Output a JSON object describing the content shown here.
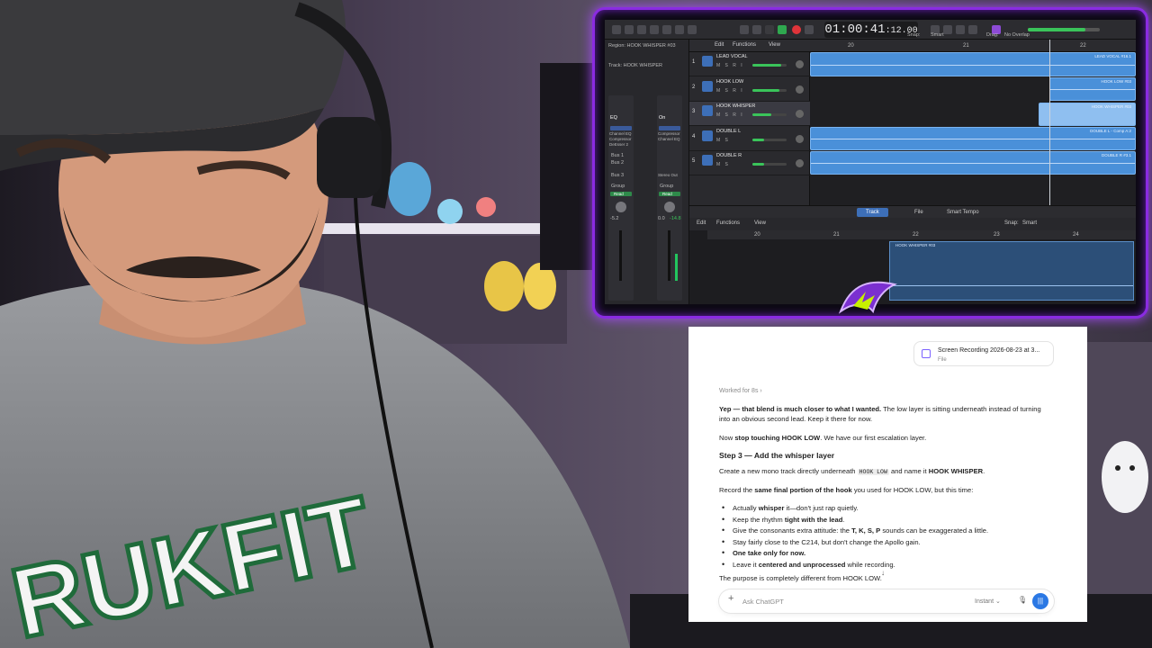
{
  "daw": {
    "region_label": "Region: HOOK WHISPER #03",
    "track_label": "Track: HOOK WHISPER",
    "menu": {
      "edit": "Edit",
      "functions": "Functions",
      "view": "View"
    },
    "snap_label": "Snap:",
    "snap_value": "Smart",
    "drag_label": "Drag:",
    "drag_value": "No Overlap",
    "time": "01:00:41",
    "time_frames": "12.00",
    "ruler_marks": [
      "20",
      "21",
      "22"
    ],
    "tracks": [
      {
        "num": "1",
        "name": "LEAD VOCAL",
        "msr": "M S R I",
        "volume": 0.85
      },
      {
        "num": "2",
        "name": "HOOK LOW",
        "msr": "M S R I",
        "volume": 0.8
      },
      {
        "num": "3",
        "name": "HOOK WHISPER",
        "msr": "M S R I",
        "volume": 0.55
      },
      {
        "num": "4",
        "name": "DOUBLE L",
        "msr": "M S",
        "volume": 0.35
      },
      {
        "num": "5",
        "name": "DOUBLE R",
        "msr": "M S",
        "volume": 0.35
      }
    ],
    "regions": {
      "lead": "LEAD VOCAL #16.1",
      "hook_low": "HOOK LOW #03",
      "hook_whisper": "HOOK WHISPER #03",
      "double_l": "DOUBLE L - Comp A:2",
      "double_r": "DOUBLE R #3.1"
    },
    "inspector": {
      "eq": "EQ",
      "on": "On",
      "plug1": "Channel EQ",
      "plug2": "Compressor",
      "plug3": "DeEsser 2",
      "bus1": "Bus 1",
      "bus2": "Bus 2",
      "bus3": "Bus 3",
      "stereo_out": "Stereo Out",
      "group": "Group",
      "read": "Read",
      "val1": "-5.2",
      "val2": "0.0",
      "val3": "-14.8"
    },
    "editor_tabs": [
      "Track",
      "File",
      "Smart Tempo"
    ],
    "editor_menu": {
      "edit": "Edit",
      "functions": "Functions",
      "view": "View"
    },
    "editor_snap_label": "Snap:",
    "editor_snap_value": "Smart",
    "editor_ruler": [
      "20",
      "21",
      "22",
      "23",
      "24"
    ],
    "editor_region": "HOOK WHISPER #03"
  },
  "chat": {
    "attachment": {
      "title": "Screen Recording 2026-08-23 at 3...",
      "type": "File"
    },
    "worked": "Worked for 8s",
    "p1_bold": "Yep — that blend is much closer to what I wanted.",
    "p1_rest": " The low layer is sitting underneath instead of turning into an obvious second lead. Keep it there for now.",
    "p2_pre": "Now ",
    "p2_bold": "stop touching HOOK LOW",
    "p2_rest": ". We have our first escalation layer.",
    "step_heading": "Step 3 — Add the whisper layer",
    "p3_pre": "Create a new mono track directly underneath ",
    "p3_code": "HOOK LOW",
    "p3_mid": " and name it ",
    "p3_bold": "HOOK WHISPER",
    "p3_end": ".",
    "p4_pre": "Record the ",
    "p4_bold": "same final portion of the hook",
    "p4_rest": " you used for HOOK LOW, but this time:",
    "bullets": [
      {
        "pre": "Actually ",
        "bold": "whisper",
        "rest": " it—don't just rap quietly."
      },
      {
        "pre": "Keep the rhythm ",
        "bold": "tight with the lead",
        "rest": "."
      },
      {
        "pre": "Give the consonants extra attitude: the ",
        "bold": "T, K, S, P",
        "rest": " sounds can be exaggerated a little."
      },
      {
        "pre": "Stay fairly close to the C214, but don't change the Apollo gain.",
        "bold": "",
        "rest": ""
      },
      {
        "pre": "",
        "bold": "One take only for now.",
        "rest": ""
      },
      {
        "pre": "Leave it ",
        "bold": "centered and unprocessed",
        "rest": " while recording."
      }
    ],
    "p5": "The purpose is completely different from HOOK LOW.",
    "input_placeholder": "Ask ChatGPT",
    "mode": "Instant",
    "plus": "+",
    "scroll_arrow": "↓"
  },
  "colors": {
    "frame_glow": "#a84bff",
    "region_blue": "#4a90d9",
    "send_blue": "#2b78e4"
  }
}
